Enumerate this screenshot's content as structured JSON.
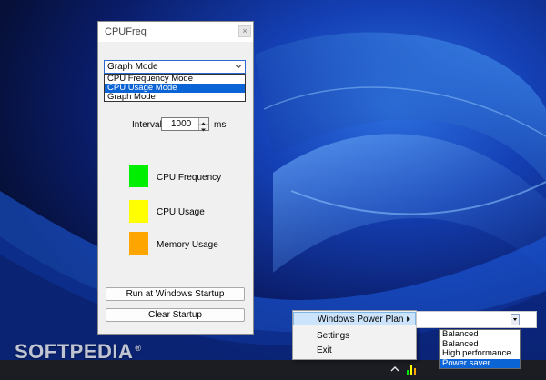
{
  "window": {
    "title": "CPUFreq",
    "close_glyph": "×"
  },
  "mode_combo": {
    "selected": "Graph Mode",
    "options": [
      "CPU Frequency Mode",
      "CPU Usage Mode",
      "Graph Mode"
    ],
    "highlighted_index": 1
  },
  "interval": {
    "label": "Interval",
    "value": "1000",
    "unit": "ms"
  },
  "legend": [
    {
      "label": "CPU Frequency",
      "color": "#00ee00"
    },
    {
      "label": "CPU Usage",
      "color": "#ffff00"
    },
    {
      "label": "Memory Usage",
      "color": "#ffa500"
    }
  ],
  "buttons": {
    "run_startup": "Run at Windows Startup",
    "clear_startup": "Clear Startup"
  },
  "tray_menu": {
    "items": [
      "Windows Power Plan",
      "Settings",
      "Exit"
    ],
    "highlighted_index": 0
  },
  "power_plan": {
    "selected": "Balanced",
    "options": [
      "Balanced",
      "High performance",
      "Power saver"
    ],
    "highlighted_index": 2
  },
  "watermark": {
    "text": "SOFTPEDIA",
    "mark": "®"
  },
  "icons": {
    "tray_overflow": "chevron-up-icon",
    "tray_app": "bar-graph-icon",
    "submenu": "triangle-right-icon",
    "dropdown": "chevron-down-icon"
  }
}
